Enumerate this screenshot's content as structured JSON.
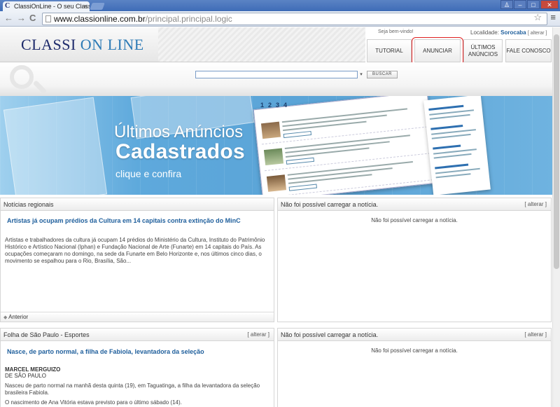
{
  "browser": {
    "tab_title": "ClassiOnLine - O seu Classifi",
    "tab_close": "×",
    "favicon": "C",
    "url_host": "www.classionline.com.br",
    "url_path": "/principal.principal.logic",
    "back": "←",
    "forward": "→",
    "reload": "C",
    "star": "☆",
    "menu": "≡",
    "min": "–",
    "max": "□",
    "close": "✕",
    "user": "♙"
  },
  "header": {
    "logo_classi": "CLASSI",
    "logo_online": "ON LINE",
    "welcome": "Seja bem-vindo!",
    "locality_label": "Localidade:",
    "locality_city": "Sorocaba",
    "locality_change": "[ alterar ]",
    "menu": {
      "tutorial": "TUTORIAL",
      "anunciar": "ANUNCIAR",
      "ultimos_1": "ÚLTIMOS",
      "ultimos_2": "ANÚNCIOS",
      "fale": "FALE CONOSCO"
    }
  },
  "search": {
    "value": "",
    "dropdown_icon": "▾",
    "button": "BUSCAR"
  },
  "banner": {
    "title_line1": "Últimos Anúncios",
    "title_line2": "Cadastrados",
    "subtitle": "clique e confira",
    "pages": [
      "1",
      "2",
      "3",
      "4"
    ]
  },
  "panels": {
    "regional": {
      "title": "Notícias regionais",
      "headline": "Artistas já ocupam prédios da Cultura em 14 capitais contra extinção do MinC",
      "body": "Artistas e trabalhadores da cultura já ocupam 14 prédios do Ministério da Cultura, Instituto do Patrimônio Histórico e Artístico Nacional (Iphan) e Fundação Nacional de Arte (Funarte) em 14 capitais do País. As ocupações começaram no domingo, na sede da Funarte em Belo Horizonte e, nos últimos cinco dias, o movimento se espalhou para o Rio, Brasília, São...",
      "prev_icon": "◆",
      "prev": "Anterior"
    },
    "top_right": {
      "title": "Não foi possível carregar a notícia.",
      "alter": "[ alterar ]",
      "message": "Não foi possível carregar a notícia."
    },
    "folha": {
      "title": "Folha de São Paulo - Esportes",
      "alter": "[ alterar ]",
      "headline": "Nasce, de parto normal, a filha de Fabiola, levantadora da seleção",
      "author": "MARCEL MERGUIZO",
      "author_loc": "DE SÃO PAULO",
      "para1": "Nasceu de parto normal na manhã desta quinta (19), em Taguatinga, a filha da levantadora da seleção brasileira Fabiola.",
      "para2": "O nascimento de Ana Vitória estava previsto para o último sábado (14)."
    },
    "bottom_right": {
      "title": "Não foi possível carregar a notícia.",
      "alter": "[ alterar ]",
      "message": "Não foi possível carregar a notícia."
    }
  },
  "colors": {
    "brand_dark": "#1d2a6b",
    "brand_light": "#2e7bb6",
    "link": "#1f5f9c",
    "banner": "#5aa3d6",
    "highlight": "#e02020"
  }
}
